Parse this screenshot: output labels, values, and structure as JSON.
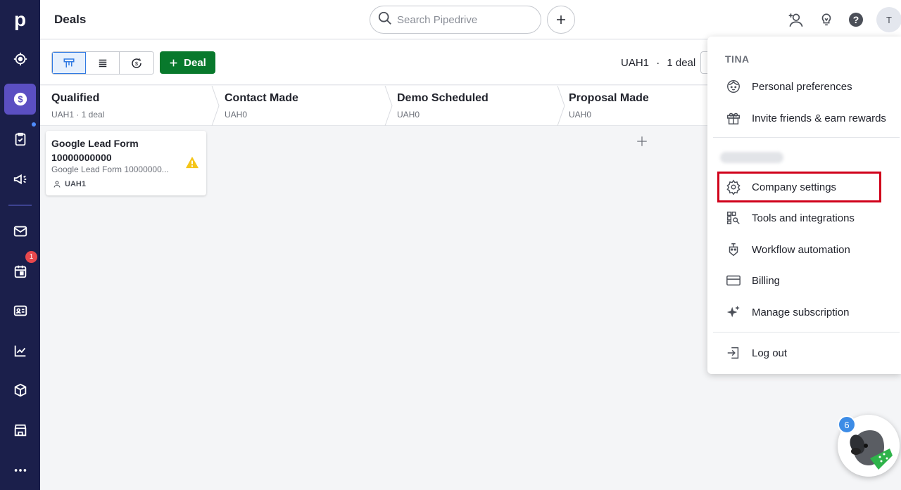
{
  "app": {
    "logo": "p",
    "notification_count": "1"
  },
  "header": {
    "title": "Deals",
    "search_placeholder": "Search Pipedrive",
    "avatar_initial": "T"
  },
  "toolbar": {
    "views": [
      "pipeline-view-icon",
      "list-view-icon",
      "forecast-view-icon"
    ],
    "add_deal_label": "Deal",
    "summary_value": "UAH1",
    "summary_sep": "·",
    "summary_count": "1 deal"
  },
  "stages": [
    {
      "name": "Qualified",
      "meta": "UAH1 · 1 deal"
    },
    {
      "name": "Contact Made",
      "meta": "UAH0"
    },
    {
      "name": "Demo Scheduled",
      "meta": "UAH0"
    },
    {
      "name": "Proposal Made",
      "meta": "UAH0"
    }
  ],
  "deal_card": {
    "title": "Google Lead Form 10000000000",
    "subtitle": "Google Lead Form 10000000...",
    "owner_value": "UAH1"
  },
  "menu": {
    "user_name": "TINA",
    "items": [
      {
        "label": "Personal preferences",
        "icon": "face-icon"
      },
      {
        "label": "Invite friends & earn rewards",
        "icon": "gift-icon"
      },
      {
        "label": "Company settings",
        "icon": "gear-icon"
      },
      {
        "label": "Tools and integrations",
        "icon": "tools-icon"
      },
      {
        "label": "Workflow automation",
        "icon": "robot-icon"
      },
      {
        "label": "Billing",
        "icon": "credit-card-icon"
      },
      {
        "label": "Manage subscription",
        "icon": "sparkle-icon"
      },
      {
        "label": "Log out",
        "icon": "logout-icon"
      }
    ]
  },
  "helper": {
    "badge_count": "6"
  },
  "colors": {
    "rail": "#1b1f4b",
    "active": "#5b4fc2",
    "primary_button": "#08792c",
    "highlight": "#d0021b"
  }
}
